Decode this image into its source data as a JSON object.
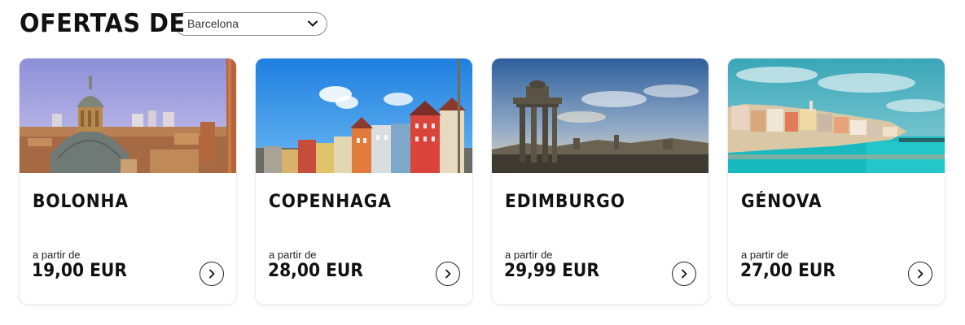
{
  "header": {
    "title": "OFERTAS DE",
    "origin_select": {
      "value": "Barcelona",
      "icon": "chevron-down-icon"
    }
  },
  "offers": [
    {
      "city": "BOLONHA",
      "from_label": "a partir de",
      "price": "19,00 EUR",
      "image": "bologna-skyline-photo"
    },
    {
      "city": "COPENHAGA",
      "from_label": "a partir de",
      "price": "28,00 EUR",
      "image": "copenhagen-nyhavn-photo"
    },
    {
      "city": "EDIMBURGO",
      "from_label": "a partir de",
      "price": "29,99 EUR",
      "image": "edinburgh-monument-photo"
    },
    {
      "city": "GÉNOVA",
      "from_label": "a partir de",
      "price": "27,00 EUR",
      "image": "genoa-coast-photo"
    }
  ],
  "colors": {
    "text": "#111111",
    "border": "#8a8a8a"
  }
}
